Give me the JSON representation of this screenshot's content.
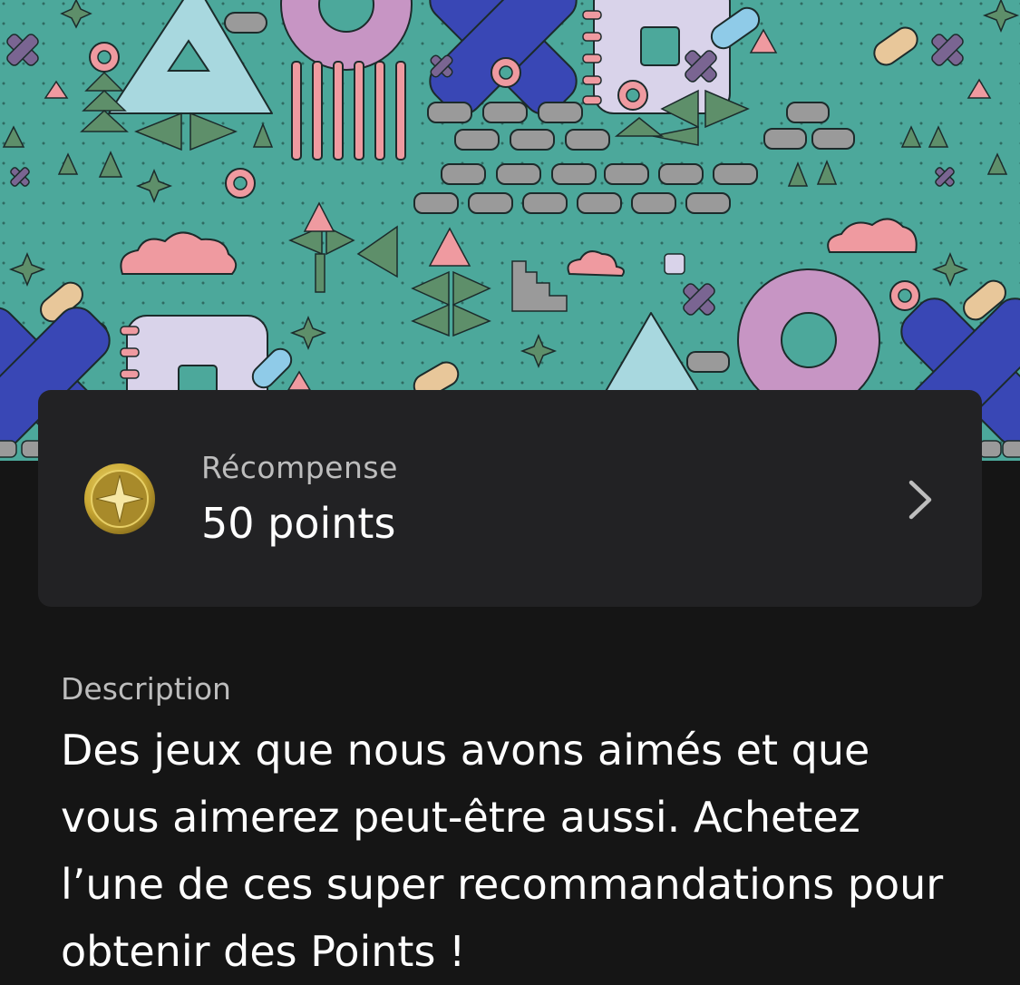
{
  "banner": {
    "icon": "playstation-shapes-pattern",
    "colors": {
      "background": "#4ca89b",
      "pink": "#ef9aa0",
      "purple": "#c795c4",
      "blue": "#3947b5",
      "light_blue": "#a8d8df",
      "grey": "#9a9a9a",
      "green": "#5e8f6a"
    }
  },
  "reward": {
    "label": "Récompense",
    "value": "50 points",
    "icon": "star-coin-icon",
    "chevron_icon": "chevron-right-icon"
  },
  "description": {
    "label": "Description",
    "text": "Des jeux que nous avons aimés et que vous aimerez peut-être aussi. Achetez l’une de ces super recommandations pour obtenir des Points !"
  },
  "colors": {
    "page_bg": "#151515",
    "card_bg": "#222224",
    "muted_text": "#bdbdbd",
    "text": "#ffffff",
    "coin_gold": "#c9a834"
  }
}
